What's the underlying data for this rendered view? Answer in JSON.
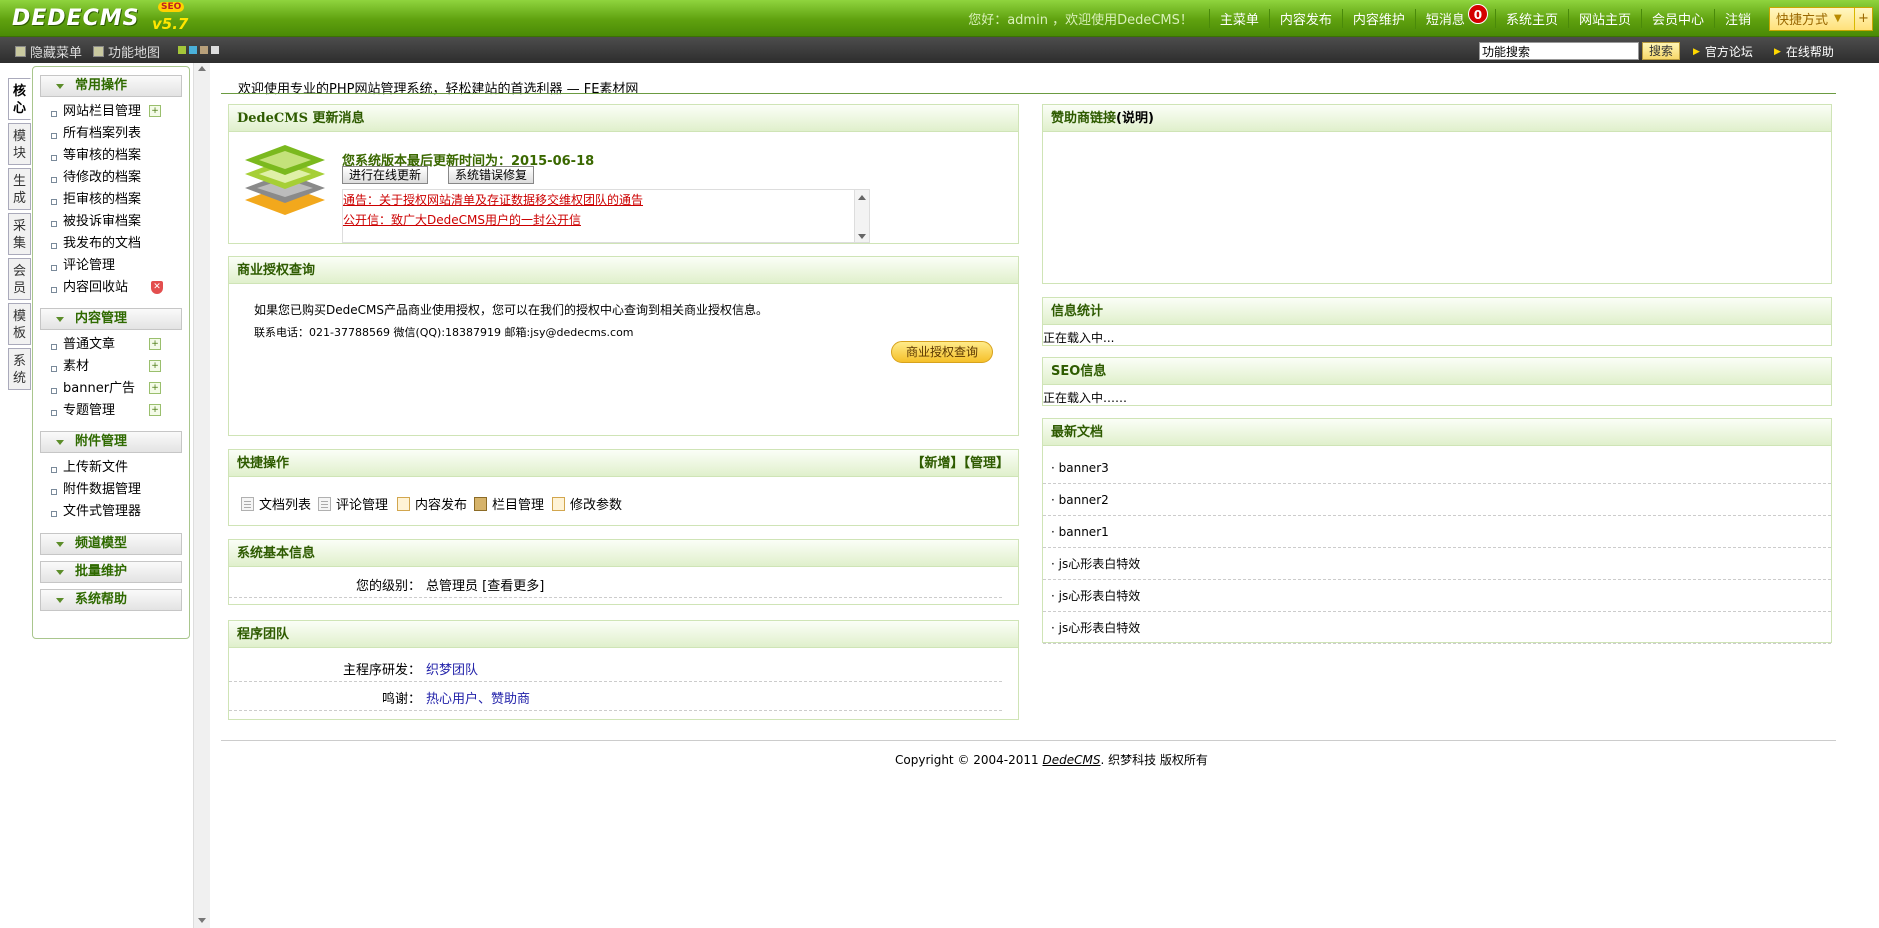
{
  "header": {
    "logo": "DEDECMS",
    "version": "v5.7",
    "edition": "SEO",
    "welcome": "您好：admin ，欢迎使用DedeCMS！",
    "nav": [
      "主菜单",
      "内容发布",
      "内容维护",
      "短消息",
      "系统主页",
      "网站主页",
      "会员中心",
      "注销"
    ],
    "message_count": "0",
    "quick_menu": "快捷方式"
  },
  "toolbar": {
    "hide_menu": "隐藏菜单",
    "function_map": "功能地图",
    "theme_colors": [
      "#a4c639",
      "#4ab0d9",
      "#b8a07a",
      "#dddddd"
    ],
    "search_value": "功能搜索",
    "search_button": "搜索",
    "official_forum": "官方论坛",
    "online_help": "在线帮助"
  },
  "left_tabs": [
    "核心",
    "模块",
    "生成",
    "采集",
    "会员",
    "模板",
    "系统"
  ],
  "menu": {
    "groups": [
      {
        "title": "常用操作",
        "items": [
          "网站栏目管理",
          "所有档案列表",
          "等审核的档案",
          "待修改的档案",
          "拒审核的档案",
          "被投诉审档案",
          "我发布的文档",
          "评论管理",
          "内容回收站"
        ]
      },
      {
        "title": "内容管理",
        "items": [
          "普通文章",
          "素材",
          "banner广告",
          "专题管理"
        ]
      },
      {
        "title": "附件管理",
        "items": [
          "上传新文件",
          "附件数据管理",
          "文件式管理器"
        ]
      },
      {
        "title": "频道模型",
        "items": []
      },
      {
        "title": "批量维护",
        "items": []
      },
      {
        "title": "系统帮助",
        "items": []
      }
    ]
  },
  "main": {
    "welcome": "欢迎使用专业的PHP网站管理系统，轻松建站的首选利器 — FE素材网",
    "update": {
      "title": "DedeCMS 更新消息",
      "last_update": "您系统版本最后更新时间为：2015-06-18",
      "online_update": "进行在线更新",
      "fix_errors": "系统错误修复",
      "news": [
        "通告：关于授权网站清单及存证数据移交维权团队的通告",
        "公开信：致广大DedeCMS用户的一封公开信"
      ]
    },
    "license": {
      "title": "商业授权查询",
      "text": "如果您已购买DedeCMS产品商业使用授权，您可以在我们的授权中心查询到相关商业授权信息。",
      "contact": "联系电话：021-37788569 微信(QQ):18387919 邮箱:jsy@dedecms.com",
      "button": "商业授权查询"
    },
    "quick": {
      "title": "快捷操作",
      "add": "【新增】",
      "manage": "【管理】",
      "items": [
        "文档列表",
        "评论管理",
        "内容发布",
        "栏目管理",
        "修改参数"
      ]
    },
    "sysinfo": {
      "title": "系统基本信息",
      "level_label": "您的级别：",
      "level_value": "总管理员 [查看更多]"
    },
    "team": {
      "title": "程序团队",
      "dev_label": "主程序研发：",
      "dev_value": "织梦团队",
      "thanks_label": "鸣谢：",
      "thanks_value": "热心用户、赞助商"
    },
    "sponsor": {
      "title": "赞助商链接",
      "note": "(说明)"
    },
    "stats": {
      "title": "信息统计",
      "status": "正在载入中..."
    },
    "seo": {
      "title": "SEO信息",
      "status": "正在载入中……"
    },
    "latest": {
      "title": "最新文档",
      "items": [
        "· banner3",
        "· banner2",
        "· banner1",
        "· js心形表白特效",
        "· js心形表白特效",
        "· js心形表白特效"
      ]
    },
    "copyright_prefix": "Copyright © 2004-2011",
    "copyright_brand": "DedeCMS",
    "copyright_suffix": ". 织梦科技 版权所有"
  }
}
